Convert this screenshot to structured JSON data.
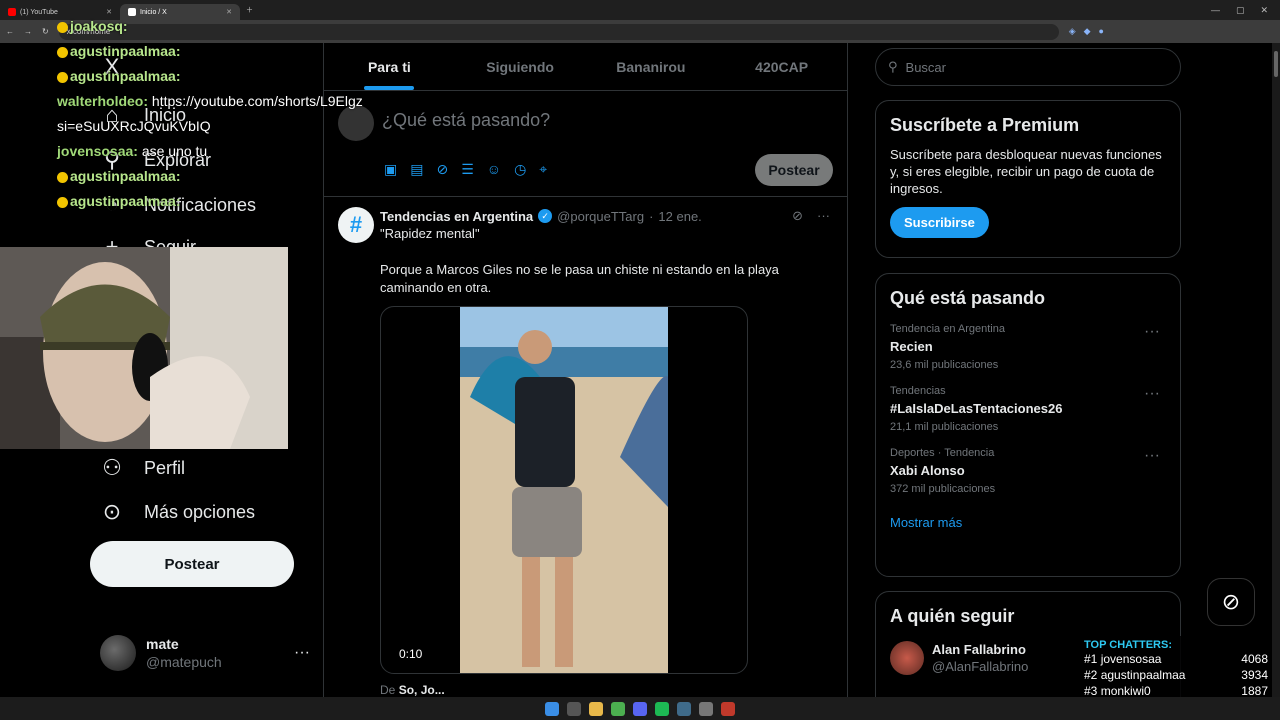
{
  "browser": {
    "tabs": [
      {
        "label": "(1) YouTube",
        "active": false
      },
      {
        "label": "Inicio / X",
        "active": true
      }
    ],
    "url": "x.com/home"
  },
  "nav": {
    "logo": "X",
    "items": [
      {
        "label": "Inicio",
        "icon": "home-icon"
      },
      {
        "label": "Explorar",
        "icon": "search-icon"
      },
      {
        "label": "Notificaciones",
        "icon": "bell-icon"
      },
      {
        "label": "Seguir",
        "icon": "follow-icon"
      },
      {
        "label": "Perfil",
        "icon": "user-icon"
      },
      {
        "label": "Más opciones",
        "icon": "more-circle-icon"
      }
    ],
    "post_label": "Postear",
    "profile": {
      "name": "mate",
      "handle": "@matepuch"
    }
  },
  "timeline": {
    "tabs": [
      {
        "label": "Para ti",
        "active": true
      },
      {
        "label": "Siguiendo",
        "active": false
      },
      {
        "label": "Bananirou",
        "active": false
      },
      {
        "label": "420CAP",
        "active": false
      }
    ],
    "composer": {
      "placeholder": "¿Qué está pasando?",
      "post_label": "Postear"
    },
    "tweet": {
      "author": "Tendencias en Argentina",
      "handle": "@porqueTTarg",
      "date": "12 ene.",
      "line1": "\"Rapidez mental\"",
      "line2": "Porque a Marcos Giles no se le pasa un chiste ni estando en la playa caminando en otra.",
      "video_time": "0:10",
      "via_prefix": "De",
      "via_name": "So, Jo..."
    }
  },
  "sidebar": {
    "search_placeholder": "Buscar",
    "premium": {
      "title": "Suscríbete a Premium",
      "text": "Suscríbete para desbloquear nuevas funciones y, si eres elegible, recibir un pago de cuota de ingresos.",
      "button": "Suscribirse"
    },
    "trends": {
      "title": "Qué está pasando",
      "items": [
        {
          "context": "Tendencia en Argentina",
          "name": "Recien",
          "count": "23,6 mil publicaciones"
        },
        {
          "context": "Tendencias",
          "name": "#LaIslaDeLasTentaciones26",
          "count": "21,1 mil publicaciones"
        },
        {
          "context": "Deportes · Tendencia",
          "name": "Xabi Alonso",
          "count": "372 mil publicaciones"
        }
      ],
      "more": "Mostrar más"
    },
    "follow": {
      "title": "A quién seguir",
      "user": {
        "name": "Alan Fallabrino",
        "handle": "@AlanFallabrino"
      }
    }
  },
  "overlay": {
    "chat": [
      {
        "user": "joakosq:",
        "msg": ""
      },
      {
        "user": "agustinpaalmaa:",
        "msg": ""
      },
      {
        "user": "agustinpaalmaa:",
        "msg": ""
      },
      {
        "user": "walterholdeo:",
        "msg": " https://youtube.com/shorts/L9Elgz"
      },
      {
        "user": "",
        "msg": "si=eSuUXRcJQvuKVbIQ"
      },
      {
        "user": "jovensosaa:",
        "msg": " ase uno tu"
      },
      {
        "user": "agustinpaalmaa:",
        "msg": ""
      },
      {
        "user": "agustinpaalmaa:",
        "msg": ""
      }
    ],
    "chatters": {
      "title": "TOP CHATTERS:",
      "rows": [
        {
          "rank": "#1",
          "name": "jovensosaa",
          "value": "4068"
        },
        {
          "rank": "#2",
          "name": "agustinpaalmaa",
          "value": "3934"
        },
        {
          "rank": "#3",
          "name": "monkiwi0",
          "value": "1887"
        }
      ]
    }
  }
}
